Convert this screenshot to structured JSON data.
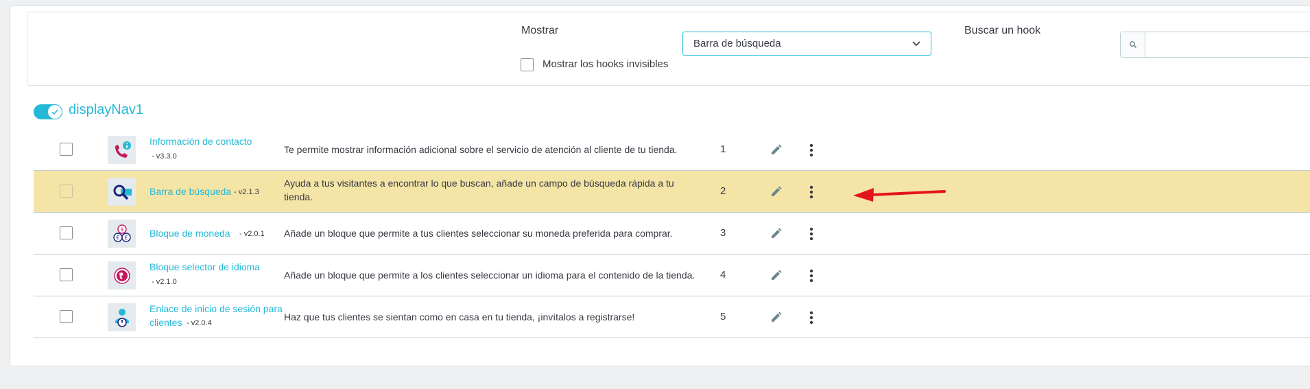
{
  "filters": {
    "show_label": "Mostrar",
    "show_selected": "Barra de búsqueda",
    "search_hook_label": "Buscar un hook",
    "search_hook_value": "",
    "show_invisible_label": "Mostrar los hooks invisibles",
    "show_invisible_checked": false
  },
  "hook": {
    "name": "displayNav1",
    "enabled": true
  },
  "modules": [
    {
      "name": "Información de contacto",
      "version": "- v3.3.0",
      "description": "Te permite mostrar información adicional sobre el servicio de atención al cliente de tu tienda.",
      "position": "1",
      "icon": "phone-info-icon",
      "highlighted": false
    },
    {
      "name": "Barra de búsqueda",
      "version": "- v2.1.3",
      "description": "Ayuda a tus visitantes a encontrar lo que buscan, añade un campo de búsqueda rápida a tu tienda.",
      "position": "2",
      "icon": "search-magnifier-icon",
      "highlighted": true
    },
    {
      "name": "Bloque de moneda",
      "version": "- v2.0.1",
      "description": "Añade un bloque que permite a tus clientes seleccionar su moneda preferida para comprar.",
      "position": "3",
      "icon": "currency-icon",
      "highlighted": false
    },
    {
      "name": "Bloque selector de idioma",
      "version": "- v2.1.0",
      "description": "Añade un bloque que permite a los clientes seleccionar un idioma para el contenido de la tienda.",
      "position": "4",
      "icon": "globe-icon",
      "highlighted": false
    },
    {
      "name": "Enlace de inicio de sesión para clientes",
      "version": "- v2.0.4",
      "description": "Haz que tus clientes se sientan como en casa en tu tienda, ¡invítalos a registrarse!",
      "position": "5",
      "icon": "user-login-icon",
      "highlighted": false
    }
  ],
  "colors": {
    "accent": "#25b9d7",
    "highlight_row": "#f4e4a6",
    "annotation_arrow": "#e3141b"
  }
}
